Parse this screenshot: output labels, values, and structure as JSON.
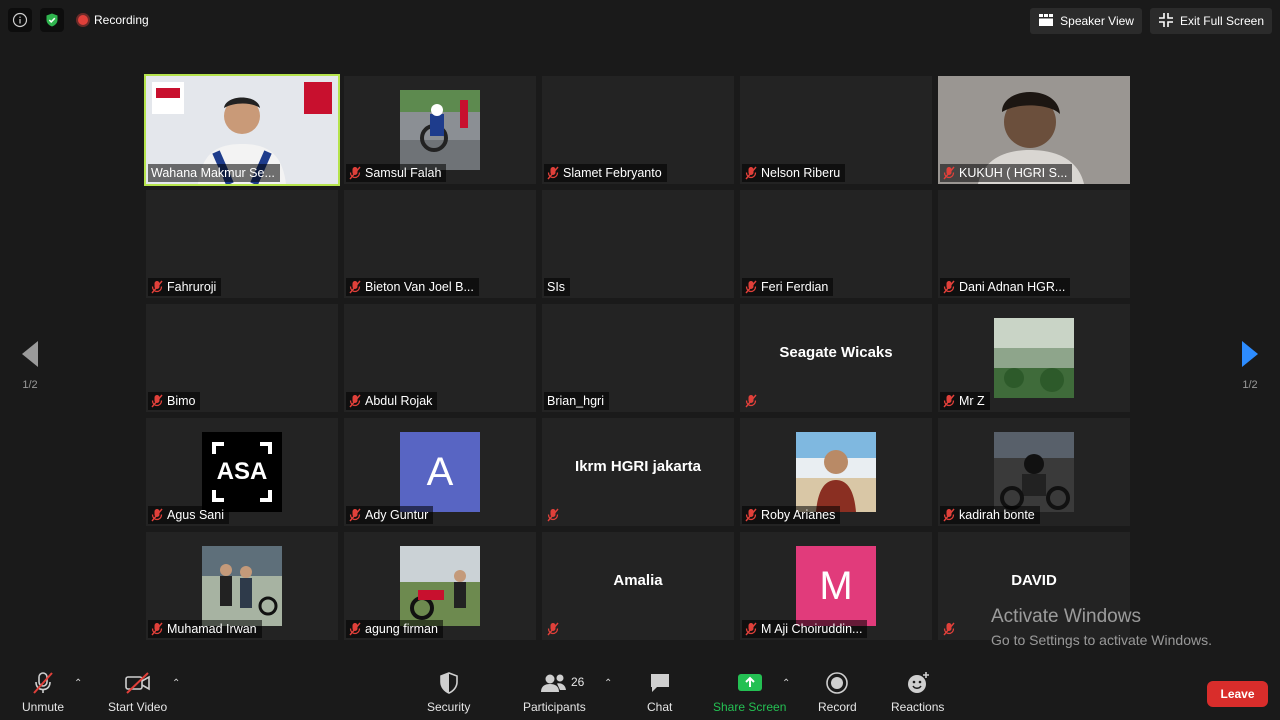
{
  "top": {
    "recording_label": "Recording",
    "speaker_view_label": "Speaker View",
    "exit_fullscreen_label": "Exit Full Screen"
  },
  "pagination": {
    "left": "1/2",
    "right": "1/2"
  },
  "participants": [
    {
      "name": "Wahana Makmur Se...",
      "muted": false,
      "video": "presenter",
      "active": true
    },
    {
      "name": "Samsul Falah",
      "muted": true,
      "video": "thumb-moto"
    },
    {
      "name": "Slamet Febryanto",
      "muted": true
    },
    {
      "name": "Nelson Riberu",
      "muted": true
    },
    {
      "name": "KUKUH ( HGRI S...",
      "muted": true,
      "video": "person-dark"
    },
    {
      "name": "Fahruroji",
      "muted": true
    },
    {
      "name": "Bieton Van Joel B...",
      "muted": true
    },
    {
      "name": "SIs",
      "muted": false
    },
    {
      "name": "Feri Ferdian",
      "muted": true
    },
    {
      "name": "Dani Adnan HGR...",
      "muted": true
    },
    {
      "name": "Bimo",
      "muted": true
    },
    {
      "name": "Abdul Rojak",
      "muted": true
    },
    {
      "name": "Brian_hgri",
      "muted": false
    },
    {
      "name": "",
      "muted": true,
      "center_name": "Seagate Wicaks"
    },
    {
      "name": "Mr Z",
      "muted": true,
      "video": "thumb-landscape"
    },
    {
      "name": "Agus Sani",
      "muted": true,
      "video": "thumb-asa",
      "thumb_text": "ASA"
    },
    {
      "name": "Ady Guntur",
      "muted": true,
      "video": "letter",
      "letter": "A",
      "letter_color": "#5865c3"
    },
    {
      "name": "",
      "muted": true,
      "center_name": "Ikrm HGRI jakarta"
    },
    {
      "name": "Roby Arianes",
      "muted": true,
      "video": "thumb-beach"
    },
    {
      "name": "kadirah bonte",
      "muted": true,
      "video": "thumb-rider"
    },
    {
      "name": "Muhamad Irwan",
      "muted": true,
      "video": "thumb-family"
    },
    {
      "name": "agung firman",
      "muted": true,
      "video": "thumb-bike-hill"
    },
    {
      "name": "",
      "muted": true,
      "center_name": "Amalia"
    },
    {
      "name": "M Aji Choiruddin...",
      "muted": true,
      "video": "letter",
      "letter": "M",
      "letter_color": "#e13b7b"
    },
    {
      "name": "",
      "muted": true,
      "center_name": "DAVID"
    }
  ],
  "watermark": {
    "line1": "Activate Windows",
    "line2": "Go to Settings to activate Windows."
  },
  "toolbar": {
    "unmute": "Unmute",
    "start_video": "Start Video",
    "security": "Security",
    "participants": "Participants",
    "participant_count": "26",
    "chat": "Chat",
    "share_screen": "Share Screen",
    "record": "Record",
    "reactions": "Reactions",
    "leave": "Leave"
  },
  "colors": {
    "active_speaker": "#b5e34c",
    "share_green": "#24c053",
    "leave_red": "#d92d2b",
    "muted_red": "#e0403a"
  },
  "icons": [
    "info-icon",
    "shield-check-icon",
    "recording-dot-icon",
    "speaker-view-icon",
    "exit-fullscreen-icon",
    "mic-muted-icon",
    "video-off-icon",
    "shield-icon",
    "participants-icon",
    "chat-icon",
    "share-screen-icon",
    "record-icon",
    "reactions-icon",
    "arrow-left-icon",
    "arrow-right-icon"
  ]
}
